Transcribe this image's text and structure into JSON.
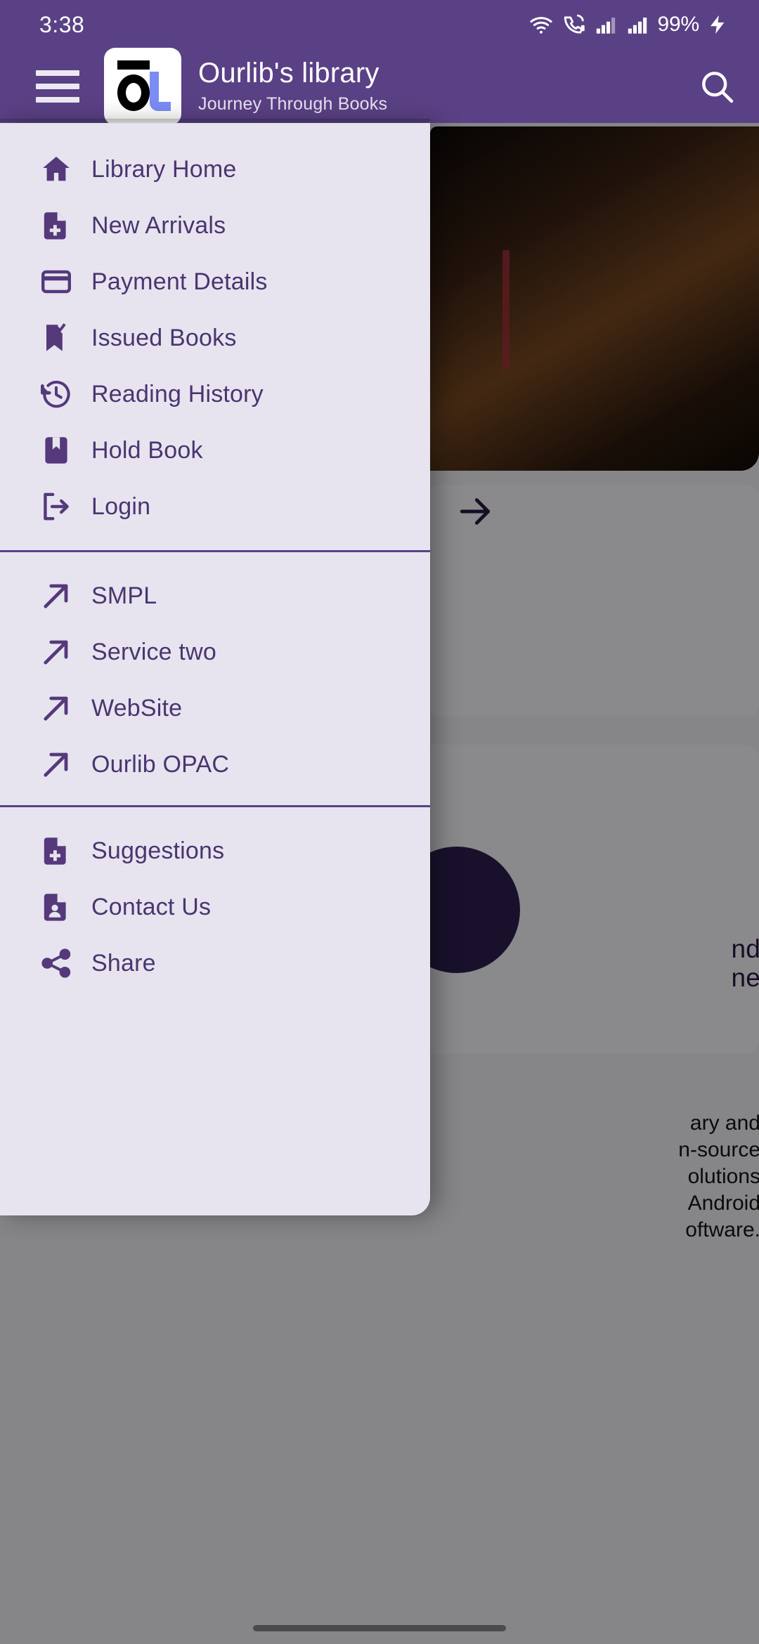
{
  "status_bar": {
    "time": "3:38",
    "battery_percent": "99%",
    "icons": [
      "wifi-icon",
      "call-signal-icon",
      "cellular-signal-1-icon",
      "cellular-signal-2-icon",
      "charging-bolt-icon"
    ]
  },
  "app_bar": {
    "menu_icon": "hamburger-menu-icon",
    "logo_alt": "ourlib-logo",
    "title": "Ourlib's library",
    "subtitle": "Journey Through Books",
    "search_icon": "search-icon"
  },
  "drawer": {
    "sections": [
      {
        "id": "primary",
        "items": [
          {
            "label": "Library Home",
            "icon": "home-icon"
          },
          {
            "label": "New Arrivals",
            "icon": "file-plus-icon"
          },
          {
            "label": "Payment Details",
            "icon": "credit-card-icon"
          },
          {
            "label": "Issued Books",
            "icon": "bookmark-check-icon"
          },
          {
            "label": "Reading History",
            "icon": "history-clock-icon"
          },
          {
            "label": "Hold Book",
            "icon": "book-bookmark-icon"
          },
          {
            "label": "Login",
            "icon": "login-exit-icon"
          }
        ]
      },
      {
        "id": "external-links",
        "items": [
          {
            "label": "SMPL",
            "icon": "external-link-arrow-icon"
          },
          {
            "label": "Service two",
            "icon": "external-link-arrow-icon"
          },
          {
            "label": "WebSite",
            "icon": "external-link-arrow-icon"
          },
          {
            "label": "Ourlib OPAC",
            "icon": "external-link-arrow-icon"
          }
        ]
      },
      {
        "id": "support",
        "items": [
          {
            "label": "Suggestions",
            "icon": "file-plus-icon"
          },
          {
            "label": "Contact Us",
            "icon": "file-person-icon"
          },
          {
            "label": "Share",
            "icon": "share-nodes-icon"
          }
        ]
      }
    ]
  },
  "background": {
    "next_arrow_icon": "arrow-right-icon",
    "headline_lines": [
      "nd",
      "ne"
    ],
    "paragraph_lines": [
      "ary  and",
      "n-source",
      "olutions",
      "Android",
      "oftware."
    ]
  },
  "colors": {
    "brand_purple": "#5a4185",
    "drawer_bg": "#e7e4ef",
    "drawer_text": "#4a3570",
    "icon_purple": "#55397b",
    "logo_accent_blue": "#7b8cf5",
    "divider": "#5a4185"
  },
  "gesture_bar": {
    "handle": "home-gesture-handle"
  }
}
